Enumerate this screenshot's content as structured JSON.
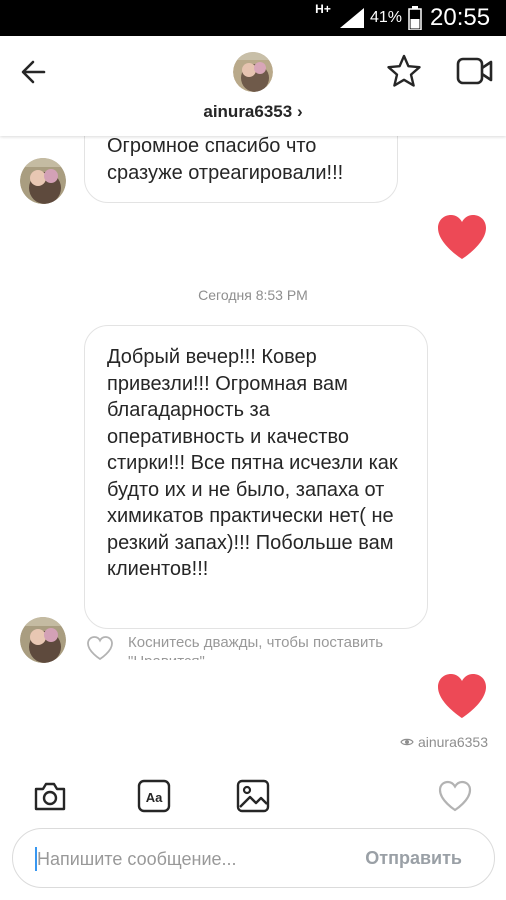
{
  "status_bar": {
    "network": "H+",
    "battery": "41%",
    "time": "20:55"
  },
  "header": {
    "username": "ainura6353",
    "chevron": "›",
    "icons": [
      "back-arrow-icon",
      "star-icon",
      "video-call-icon"
    ]
  },
  "messages": [
    {
      "text": "Огромное спасибо что сразуже отреагировали!!!"
    },
    {
      "text": "Добрый вечер!!! Ковер привезли!!! Огромная вам благадарность за оперативность и качество стирки!!! Все пятна исчезли как будто их и не было, запаха от химикатов практически нет( не резкий запах)!!! Побольше вам клиентов!!!"
    }
  ],
  "timestamp": "Сегодня 8:53 PM",
  "like_hint": "Коснитесь дважды, чтобы поставить \"Нравится\"",
  "seen_by": "ainura6353",
  "colors": {
    "heart": "#ed4956",
    "send_disabled": "#9aa0a6",
    "cursor": "#3897f0"
  },
  "composer": {
    "placeholder": "Напишите сообщение...",
    "send_label": "Отправить"
  },
  "toolbar": [
    "camera-icon",
    "text-icon",
    "gallery-icon",
    "heart-icon"
  ]
}
